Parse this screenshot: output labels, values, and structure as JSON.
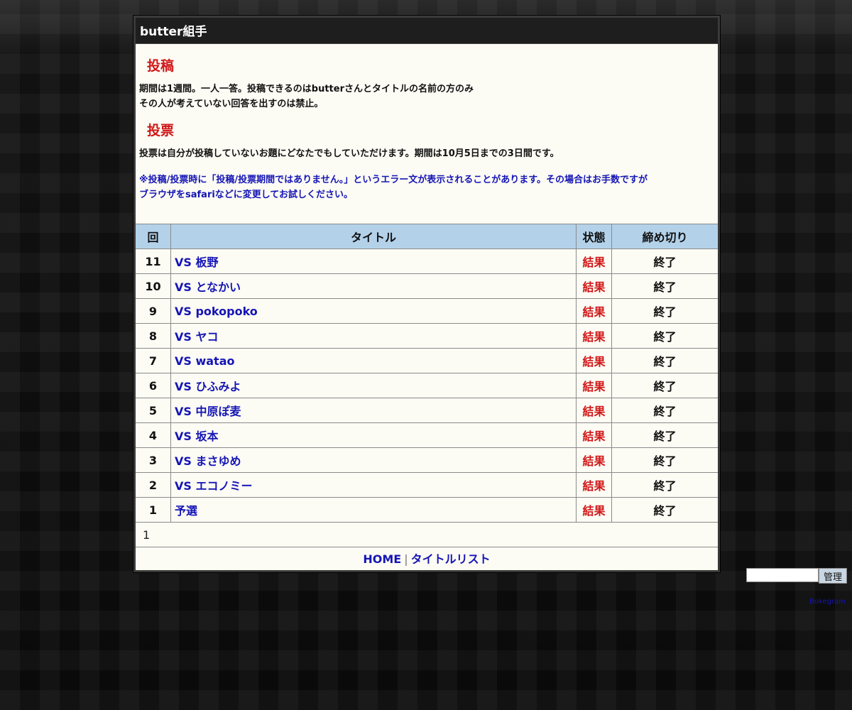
{
  "panel": {
    "title": "butter組手"
  },
  "post_section": {
    "heading": "投稿",
    "line1": "期間は1週間。一人一答。投稿できるのはbutterさんとタイトルの名前の方のみ",
    "line2": "その人が考えていない回答を出すのは禁止。"
  },
  "vote_section": {
    "heading": "投票",
    "line1": "投票は自分が投稿していないお題にどなたでもしていただけます。期間は10月5日までの3日間です。",
    "notice1": "※投稿/投票時に「投稿/投票期間ではありません。」というエラー文が表示されることがあります。その場合はお手数ですが",
    "notice2": "ブラウザをsafariなどに変更してお試しください。"
  },
  "table": {
    "headers": {
      "round": "回",
      "title": "タイトル",
      "state": "状態",
      "deadline": "締め切り"
    },
    "rows": [
      {
        "round": "11",
        "title": "VS 板野",
        "state": "結果",
        "deadline": "終了"
      },
      {
        "round": "10",
        "title": "VS となかい",
        "state": "結果",
        "deadline": "終了"
      },
      {
        "round": "9",
        "title": "VS pokopoko",
        "state": "結果",
        "deadline": "終了"
      },
      {
        "round": "8",
        "title": "VS ヤコ",
        "state": "結果",
        "deadline": "終了"
      },
      {
        "round": "7",
        "title": "VS watao",
        "state": "結果",
        "deadline": "終了"
      },
      {
        "round": "6",
        "title": "VS ひふみよ",
        "state": "結果",
        "deadline": "終了"
      },
      {
        "round": "5",
        "title": "VS 中原ぽ麦",
        "state": "結果",
        "deadline": "終了"
      },
      {
        "round": "4",
        "title": "VS 坂本",
        "state": "結果",
        "deadline": "終了"
      },
      {
        "round": "3",
        "title": "VS まさゆめ",
        "state": "結果",
        "deadline": "終了"
      },
      {
        "round": "2",
        "title": "VS エコノミー",
        "state": "結果",
        "deadline": "終了"
      },
      {
        "round": "1",
        "title": "予選",
        "state": "結果",
        "deadline": "終了"
      }
    ]
  },
  "pager": {
    "page": "1"
  },
  "footer_nav": {
    "home": "HOME",
    "separator": "|",
    "title_list": "タイトルリスト"
  },
  "admin": {
    "button": "管理",
    "input_value": ""
  },
  "powered": {
    "label": "Bokegram"
  },
  "colors": {
    "heading_red": "#d01818",
    "link_blue": "#1515b5",
    "table_header_bg": "#b3d2ea",
    "panel_bg": "#fcfbf4"
  }
}
